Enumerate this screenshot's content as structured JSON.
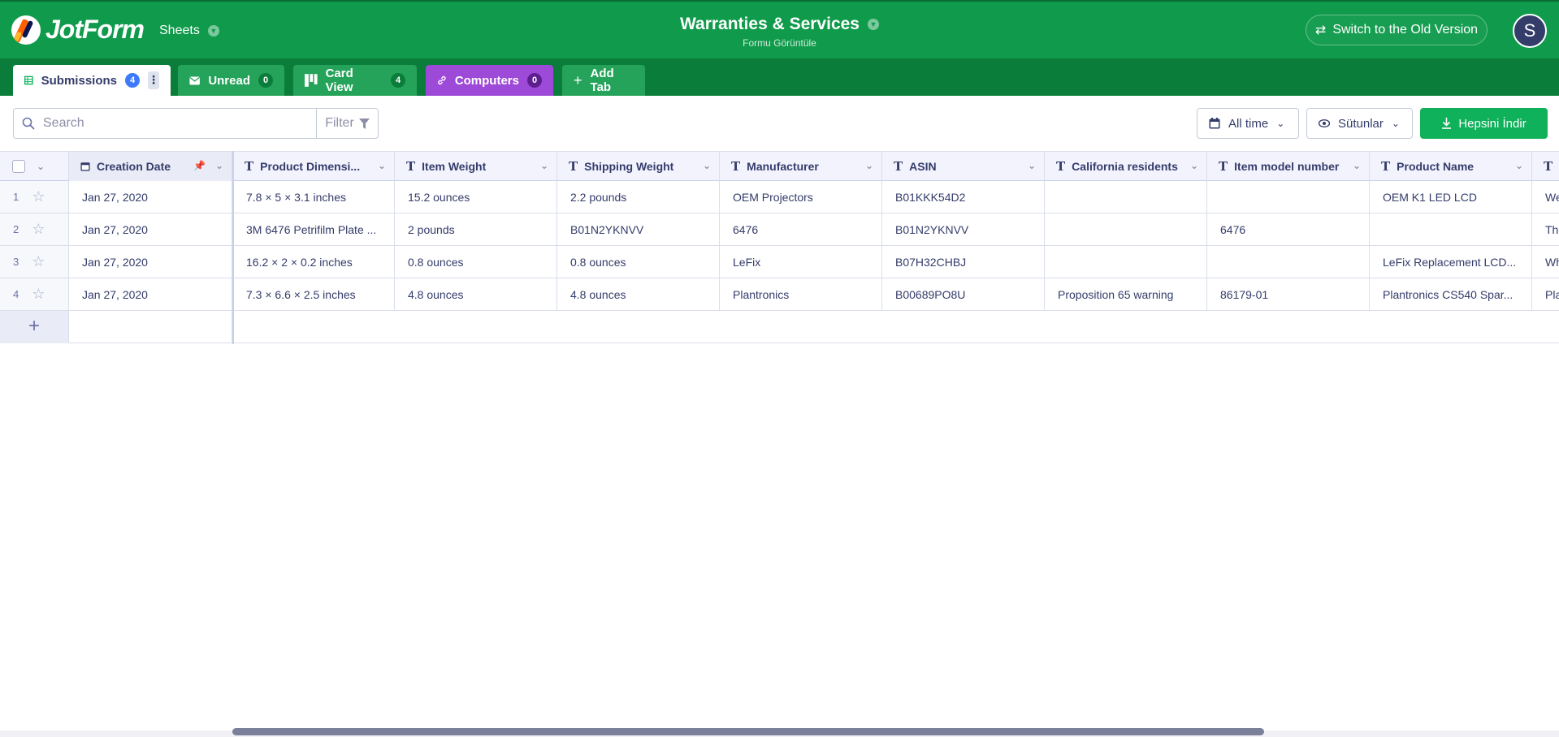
{
  "header": {
    "logo_text": "JotForm",
    "product": "Sheets",
    "title": "Warranties & Services",
    "subtitle": "Formu Görüntüle",
    "switch_label": "Switch to the Old Version",
    "avatar_initial": "S"
  },
  "tabs": [
    {
      "label": "Submissions",
      "count": "4",
      "style": "active",
      "icon": "grid-icon"
    },
    {
      "label": "Unread",
      "count": "0",
      "style": "green",
      "icon": "envelope-icon"
    },
    {
      "label": "Card View",
      "count": "4",
      "style": "green",
      "icon": "card-view-icon"
    },
    {
      "label": "Computers",
      "count": "0",
      "style": "purple",
      "icon": "link-icon"
    },
    {
      "label": "Add Tab",
      "icon": "plus-icon"
    }
  ],
  "toolbar": {
    "search_placeholder": "Search",
    "filter_label": "Filter",
    "date_range_label": "All time",
    "columns_label": "Sütunlar",
    "download_label": "Hepsini İndir"
  },
  "table": {
    "columns": [
      "Creation Date",
      "Product Dimensi...",
      "Item Weight",
      "Shipping Weight",
      "Manufacturer",
      "ASIN",
      "California residents",
      "Item model number",
      "Product Name",
      ""
    ],
    "rows": [
      {
        "num": "1",
        "cells": [
          "Jan 27, 2020",
          "7.8 × 5 × 3.1 inches",
          "15.2 ounces",
          "2.2 pounds",
          "OEM Projectors",
          "B01KKK54D2",
          "",
          "",
          "OEM K1 LED LCD",
          "We"
        ]
      },
      {
        "num": "2",
        "cells": [
          "Jan 27, 2020",
          "3M 6476 Petrifilm Plate ...",
          "2 pounds",
          "B01N2YKNVV",
          "6476",
          "B01N2YKNVV",
          "",
          "6476",
          "",
          "Th"
        ]
      },
      {
        "num": "3",
        "cells": [
          "Jan 27, 2020",
          "16.2 × 2 × 0.2 inches",
          "0.8 ounces",
          "0.8 ounces",
          "LeFix",
          "B07H32CHBJ",
          "",
          "",
          "LeFix Replacement LCD...",
          "Wh"
        ]
      },
      {
        "num": "4",
        "cells": [
          "Jan 27, 2020",
          "7.3 × 6.6 × 2.5 inches",
          "4.8 ounces",
          "4.8 ounces",
          "Plantronics",
          "B00689PO8U",
          "Proposition 65 warning",
          "86179-01",
          "Plantronics CS540 Spar...",
          "Pla"
        ]
      }
    ]
  },
  "colors": {
    "header_green": "#0f9b4b",
    "tabbar_green": "#0a7d3b",
    "accent_blue": "#3e7bfa",
    "purple_tab": "#9e4ad8",
    "download_green": "#0fb15a"
  }
}
